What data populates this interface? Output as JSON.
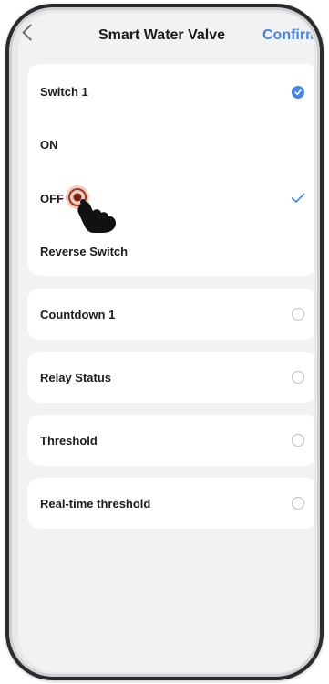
{
  "header": {
    "title": "Smart Water Valve",
    "confirm_label": "Confirm"
  },
  "main_card": {
    "switch": {
      "label": "Switch 1",
      "selected": true
    },
    "options": [
      {
        "label": "ON",
        "checked": false
      },
      {
        "label": "OFF",
        "checked": true
      }
    ],
    "reverse": {
      "label": "Reverse Switch"
    }
  },
  "items": [
    {
      "label": "Countdown 1",
      "selected": false
    },
    {
      "label": "Relay Status",
      "selected": false
    },
    {
      "label": "Threshold",
      "selected": false
    },
    {
      "label": "Real-time threshold",
      "selected": false
    }
  ],
  "colors": {
    "accent": "#4a86d8",
    "background": "#f2f2f5",
    "card": "#ffffff"
  }
}
